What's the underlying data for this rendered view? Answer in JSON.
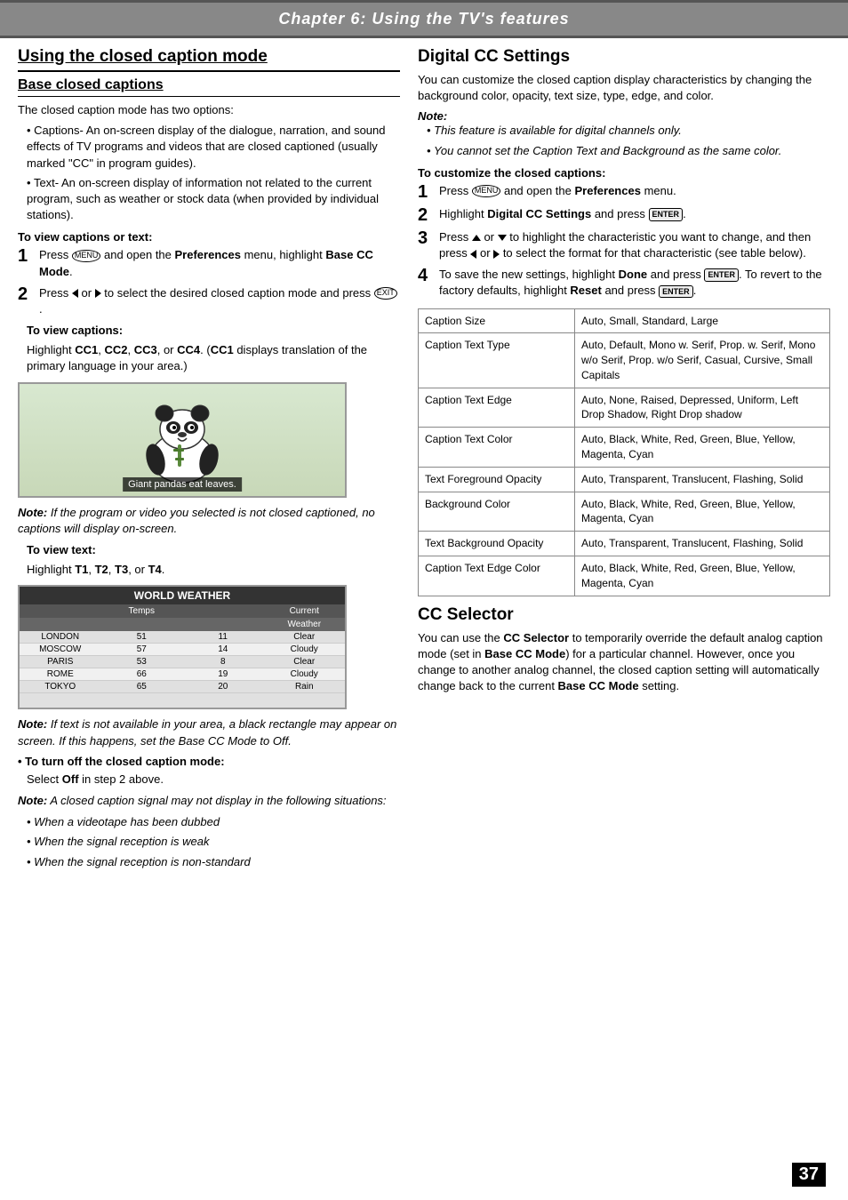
{
  "header": {
    "title": "Chapter 6: Using the TV's features"
  },
  "left": {
    "main_title": "Using the closed caption mode",
    "sub_title": "Base closed captions",
    "intro": "The closed caption mode has two options:",
    "bullets": [
      "Captions- An on-screen display of the dialogue, narration, and sound effects of TV programs and videos that are closed captioned (usually marked \"CC\" in program guides).",
      "Text- An on-screen display of information not related to the current program, such as weather or stock data (when provided by individual stations)."
    ],
    "view_heading": "To view captions or text:",
    "step1_a": "Press",
    "step1_b": " and open the ",
    "step1_c": "Preferences",
    "step1_d": " menu, highlight ",
    "step1_e": "Base CC Mode",
    "step1_f": ".",
    "step2_a": "Press ",
    "step2_b": " or ",
    "step2_c": " to select the desired closed caption mode and press ",
    "step2_d": "EXIT",
    "step2_e": ".",
    "view_captions_heading": "To view captions:",
    "view_captions_text": "Highlight CC1, CC2, CC3, or CC4. (CC1 displays translation of the primary language in your area.)",
    "panda_caption": "Giant pandas eat leaves.",
    "note1_label": "Note:",
    "note1_text": " If the program or video you selected is not closed captioned, no captions will display on-screen.",
    "view_text_heading": "To view text:",
    "view_text_content": "Highlight T1, T2, T3, or T4.",
    "note2_label": "Note:",
    "note2_text": " If text is not available in your area, a black rectangle may appear on screen. If this happens, set the Base CC Mode to Off.",
    "turn_off_heading": "To turn off the closed caption mode:",
    "turn_off_text": "Select Off in step 2 above.",
    "note3_label": "Note:",
    "note3_text": " A closed caption signal may not display in the following situations:",
    "situations": [
      "When a videotape has been dubbed",
      "When the signal reception is weak",
      "When the signal reception is non-standard"
    ],
    "weather": {
      "title": "WORLD WEATHER",
      "subheaders": [
        "",
        "Temps",
        "",
        "Current"
      ],
      "subheaders2": [
        "",
        "",
        "",
        "Weather"
      ],
      "rows": [
        [
          "LONDON",
          "51",
          "11",
          "Clear"
        ],
        [
          "MOSCOW",
          "57",
          "14",
          "Cloudy"
        ],
        [
          "PARIS",
          "53",
          "8",
          "Clear"
        ],
        [
          "ROME",
          "66",
          "19",
          "Cloudy"
        ],
        [
          "TOKYO",
          "65",
          "20",
          "Rain"
        ]
      ]
    }
  },
  "right": {
    "digital_title": "Digital CC Settings",
    "digital_intro": "You can customize the closed caption display characteristics by changing the background color, opacity, text size, type, edge, and color.",
    "note_label": "Note:",
    "note_digital1": "This feature is available for digital channels only.",
    "note_digital2": "You cannot set the Caption Text and Background as the same color.",
    "customize_heading": "To customize the closed captions:",
    "step1_text": " and open the ",
    "step1_bold": "Preferences",
    "step1_rest": " menu.",
    "step2_text": "Highlight ",
    "step2_bold": "Digital CC Settings",
    "step2_rest": " and press ",
    "step3_text": "Press ",
    "step3_rest": " or ",
    "step3_rest2": " to highlight the characteristic you want to change, and then press ",
    "step3_rest3": " or ",
    "step3_rest4": " to select the format for that characteristic (see table below).",
    "step4_text": "To save the new settings, highlight ",
    "step4_bold1": "Done",
    "step4_rest1": " and press ",
    "step4_rest2": ". To revert to the factory defaults, highlight ",
    "step4_bold2": "Reset",
    "step4_rest3": " and press ",
    "table": {
      "rows": [
        {
          "label": "Caption Size",
          "value": "Auto, Small, Standard, Large"
        },
        {
          "label": "Caption Text Type",
          "value": "Auto, Default, Mono w. Serif, Prop. w. Serif, Mono w/o Serif, Prop. w/o Serif, Casual, Cursive, Small Capitals"
        },
        {
          "label": "Caption Text Edge",
          "value": "Auto, None, Raised, Depressed, Uniform, Left Drop Shadow, Right Drop shadow"
        },
        {
          "label": "Caption Text Color",
          "value": "Auto, Black, White, Red, Green, Blue, Yellow, Magenta, Cyan"
        },
        {
          "label": "Text Foreground Opacity",
          "value": "Auto, Transparent, Translucent, Flashing, Solid"
        },
        {
          "label": "Background Color",
          "value": "Auto, Black, White, Red, Green, Blue, Yellow, Magenta, Cyan"
        },
        {
          "label": "Text Background Opacity",
          "value": "Auto, Transparent, Translucent, Flashing, Solid"
        },
        {
          "label": "Caption Text Edge Color",
          "value": "Auto, Black, White, Red, Green, Blue, Yellow, Magenta, Cyan"
        }
      ]
    },
    "cc_selector_title": "CC Selector",
    "cc_selector_text1": "You can use the ",
    "cc_selector_bold1": "CC Selector",
    "cc_selector_text2": " to temporarily override the default analog caption mode (set in ",
    "cc_selector_bold2": "Base CC Mode",
    "cc_selector_text3": ") for a particular channel. However, once you change to another analog channel, the closed caption setting will automatically change back to the current ",
    "cc_selector_bold3": "Base CC Mode",
    "cc_selector_text4": " setting."
  },
  "page_number": "37"
}
